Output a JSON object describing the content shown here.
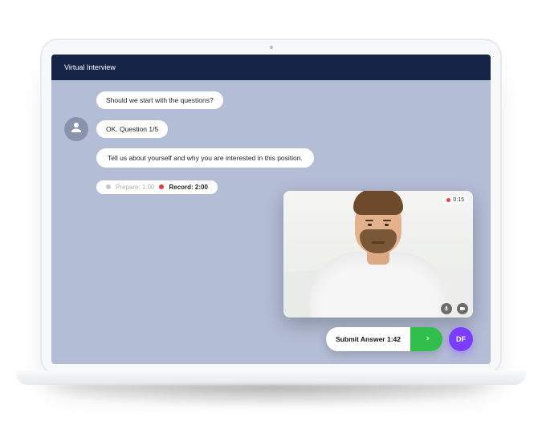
{
  "header": {
    "title": "Virtual Interview"
  },
  "chat": {
    "msg_start": "Should we start with the questions?",
    "msg_qnum": "OK. Question 1/5",
    "msg_question": "Tell us about yourself and why you are interested in this position."
  },
  "timers": {
    "prepare_label": "Prepare: 1:00",
    "record_label": "Record: 2:00"
  },
  "video": {
    "rec_badge": "0:15"
  },
  "submit": {
    "label": "Submit Answer 1:42"
  },
  "user": {
    "initials": "DF"
  },
  "colors": {
    "header": "#162447",
    "screen_bg": "#b4bdd6",
    "accent_green": "#2fbf4a",
    "accent_purple": "#7a3cff",
    "rec_red": "#e43f3a"
  }
}
